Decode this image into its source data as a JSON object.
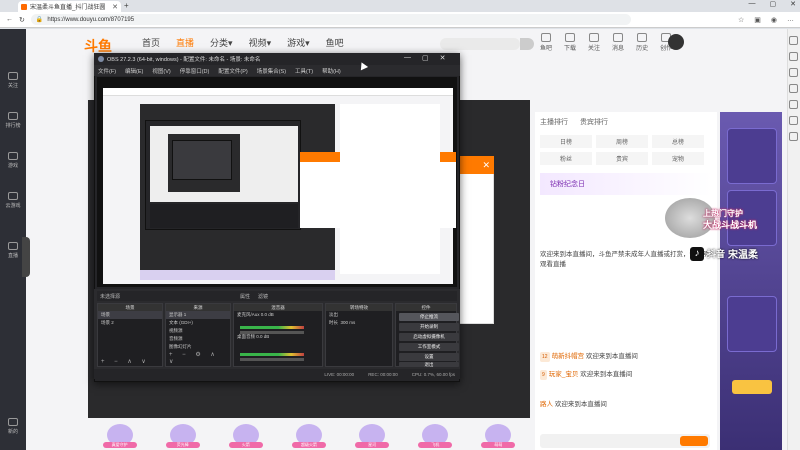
{
  "browser": {
    "tab_title": "宋温柔斗鱼直播_抖门战狂圆",
    "new_tab": "+",
    "window_controls": [
      "—",
      "▢",
      "✕"
    ],
    "url": "https://www.douyu.com/8707195"
  },
  "site": {
    "logo": "斗鱼",
    "nav": [
      "首页",
      "直播",
      "分类▾",
      "视频▾",
      "游戏▾",
      "鱼吧"
    ],
    "header_icons": [
      "鱼吧",
      "下载",
      "关注",
      "消息",
      "历史",
      "创作"
    ],
    "left_nav": [
      "关注",
      "排行榜",
      "游戏",
      "云游戏",
      "直播",
      "新的"
    ],
    "gifts": [
      "真爱守护",
      "荧光棒",
      "火箭",
      "超级火箭",
      "星河",
      "飞机",
      "萌萌"
    ]
  },
  "right_panel": {
    "tabs": [
      "主播排行",
      "贵宾排行"
    ],
    "grid": [
      "日榜",
      "周榜",
      "总榜",
      "粉丝",
      "贵宾",
      "宠物"
    ],
    "banner": "钻粉纪念日",
    "chat": [
      {
        "lvl": "",
        "name": "",
        "text": "欢迎来到本直播间，斗鱼严禁未成年人直播或打赏，请文明观看直播"
      },
      {
        "lvl": "12",
        "name": "萌新抖帽宫",
        "text": "欢迎来到本直播间"
      },
      {
        "lvl": "9",
        "name": "玩家_宝贝",
        "text": "欢迎来到本直播间"
      },
      {
        "lvl": "",
        "name": "路人",
        "text": "欢迎来到本直播间"
      }
    ]
  },
  "overlays": {
    "watermark_top": "上热门守护",
    "watermark_sub": "大战斗战斗机",
    "tiktok_logo": "♪",
    "tiktok_brand": "抖音",
    "tiktok_user": "宋温柔"
  },
  "obs": {
    "title": "OBS 27.2.3 (64-bit, windows) - 配置文件: 未命名 - 场景: 未命名",
    "menu": [
      "文件(F)",
      "编辑(E)",
      "视图(V)",
      "停靠窗口(D)",
      "配置文件(P)",
      "场景集合(S)",
      "工具(T)",
      "帮助(H)"
    ],
    "selector_left": "未选择源",
    "selector_tabs": [
      "属性",
      "滤镜"
    ],
    "docks": {
      "scenes": {
        "title": "场景",
        "items": [
          "场景",
          "场景 2"
        ]
      },
      "sources": {
        "title": "来源",
        "items": [
          "显示器 1",
          "文本 (GDI+)",
          "视频源",
          "音频源",
          "图像幻灯片"
        ]
      },
      "mixer": {
        "title": "混音器",
        "tracks": [
          {
            "name": "麦克风/Aux",
            "db": "0.0 dB"
          },
          {
            "name": "桌面音频",
            "db": "0.0 dB"
          }
        ]
      },
      "transitions": {
        "title": "转场特效",
        "type": "淡出",
        "duration_label": "时长",
        "duration": "300 ms"
      },
      "controls": {
        "title": "控件",
        "buttons": [
          "停止推流",
          "开始录制",
          "启动虚拟摄像机",
          "工作室模式",
          "设置",
          "退出"
        ]
      }
    },
    "status": [
      "LIVE: 00:00:00",
      "REC: 00:00:00",
      "CPU: 0.7%, 60.00 fps"
    ]
  },
  "popup_close": "✕"
}
